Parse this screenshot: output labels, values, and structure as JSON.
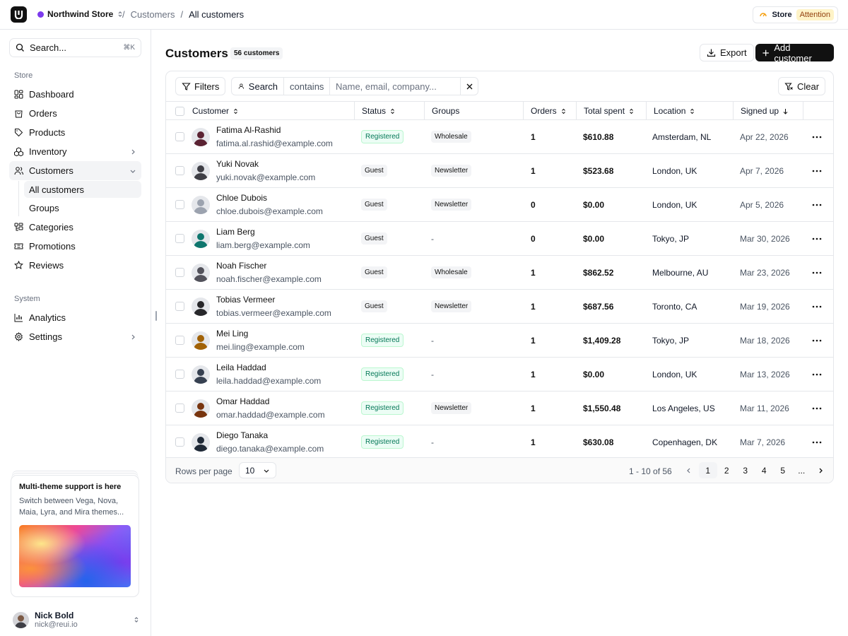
{
  "topbar": {
    "store_name": "Northwind Store",
    "breadcrumb": [
      "Customers",
      "All customers"
    ],
    "status_label": "Store",
    "status_badge": "Attention"
  },
  "sidebar": {
    "search_label": "Search...",
    "search_shortcut": "⌘K",
    "store_group": "Store",
    "store_items": [
      {
        "label": "Dashboard",
        "icon": "dashboard-icon"
      },
      {
        "label": "Orders",
        "icon": "shopping-bag-icon"
      },
      {
        "label": "Products",
        "icon": "tag-icon"
      },
      {
        "label": "Inventory",
        "icon": "boxes-icon"
      },
      {
        "label": "Customers",
        "icon": "users-icon"
      }
    ],
    "customers_sub": [
      "All customers",
      "Groups"
    ],
    "store_items_after": [
      {
        "label": "Categories",
        "icon": "categories-icon"
      },
      {
        "label": "Promotions",
        "icon": "ticket-icon"
      },
      {
        "label": "Reviews",
        "icon": "star-icon"
      }
    ],
    "system_group": "System",
    "system_items": [
      {
        "label": "Analytics",
        "icon": "chart-icon"
      },
      {
        "label": "Settings",
        "icon": "gear-icon"
      }
    ],
    "promo": {
      "title": "Multi-theme support is here",
      "text": "Switch between Vega, Nova, Maia, Lyra, and Mira themes..."
    },
    "user": {
      "name": "Nick Bold",
      "email": "nick@reui.io"
    }
  },
  "main": {
    "title": "Customers",
    "count": "56 customers",
    "export_label": "Export",
    "add_label": "Add customer",
    "filters_label": "Filters",
    "filter_field": "Search",
    "filter_op": "contains",
    "filter_placeholder": "Name, email, company...",
    "clear_label": "Clear"
  },
  "table": {
    "columns": [
      "Customer",
      "Status",
      "Groups",
      "Orders",
      "Total spent",
      "Location",
      "Signed up"
    ],
    "rows": [
      {
        "name": "Fatima Al-Rashid",
        "email": "fatima.al.rashid@example.com",
        "status": "Registered",
        "group": "Wholesale",
        "orders": "1",
        "total": "$610.88",
        "location": "Amsterdam, NL",
        "signed": "Apr 22, 2026"
      },
      {
        "name": "Yuki Novak",
        "email": "yuki.novak@example.com",
        "status": "Guest",
        "group": "Newsletter",
        "orders": "1",
        "total": "$523.68",
        "location": "London, UK",
        "signed": "Apr 7, 2026"
      },
      {
        "name": "Chloe Dubois",
        "email": "chloe.dubois@example.com",
        "status": "Guest",
        "group": "Newsletter",
        "orders": "0",
        "total": "$0.00",
        "location": "London, UK",
        "signed": "Apr 5, 2026"
      },
      {
        "name": "Liam Berg",
        "email": "liam.berg@example.com",
        "status": "Guest",
        "group": "-",
        "orders": "0",
        "total": "$0.00",
        "location": "Tokyo, JP",
        "signed": "Mar 30, 2026"
      },
      {
        "name": "Noah Fischer",
        "email": "noah.fischer@example.com",
        "status": "Guest",
        "group": "Wholesale",
        "orders": "1",
        "total": "$862.52",
        "location": "Melbourne, AU",
        "signed": "Mar 23, 2026"
      },
      {
        "name": "Tobias Vermeer",
        "email": "tobias.vermeer@example.com",
        "status": "Guest",
        "group": "Newsletter",
        "orders": "1",
        "total": "$687.56",
        "location": "Toronto, CA",
        "signed": "Mar 19, 2026"
      },
      {
        "name": "Mei Ling",
        "email": "mei.ling@example.com",
        "status": "Registered",
        "group": "-",
        "orders": "1",
        "total": "$1,409.28",
        "location": "Tokyo, JP",
        "signed": "Mar 18, 2026"
      },
      {
        "name": "Leila Haddad",
        "email": "leila.haddad@example.com",
        "status": "Registered",
        "group": "-",
        "orders": "1",
        "total": "$0.00",
        "location": "London, UK",
        "signed": "Mar 13, 2026"
      },
      {
        "name": "Omar Haddad",
        "email": "omar.haddad@example.com",
        "status": "Registered",
        "group": "Newsletter",
        "orders": "1",
        "total": "$1,550.48",
        "location": "Los Angeles, US",
        "signed": "Mar 11, 2026"
      },
      {
        "name": "Diego Tanaka",
        "email": "diego.tanaka@example.com",
        "status": "Registered",
        "group": "-",
        "orders": "1",
        "total": "$630.08",
        "location": "Copenhagen, DK",
        "signed": "Mar 7, 2026"
      }
    ],
    "avatar_colors": [
      "#5b2333",
      "#3f3f46",
      "#9ca3af",
      "#0f766e",
      "#52525b",
      "#27272a",
      "#a16207",
      "#374151",
      "#78350f",
      "#1f2937"
    ]
  },
  "pagination": {
    "rows_label": "Rows per page",
    "rows_value": "10",
    "range": "1 - 10 of 56",
    "pages": [
      "1",
      "2",
      "3",
      "4",
      "5",
      "..."
    ]
  }
}
